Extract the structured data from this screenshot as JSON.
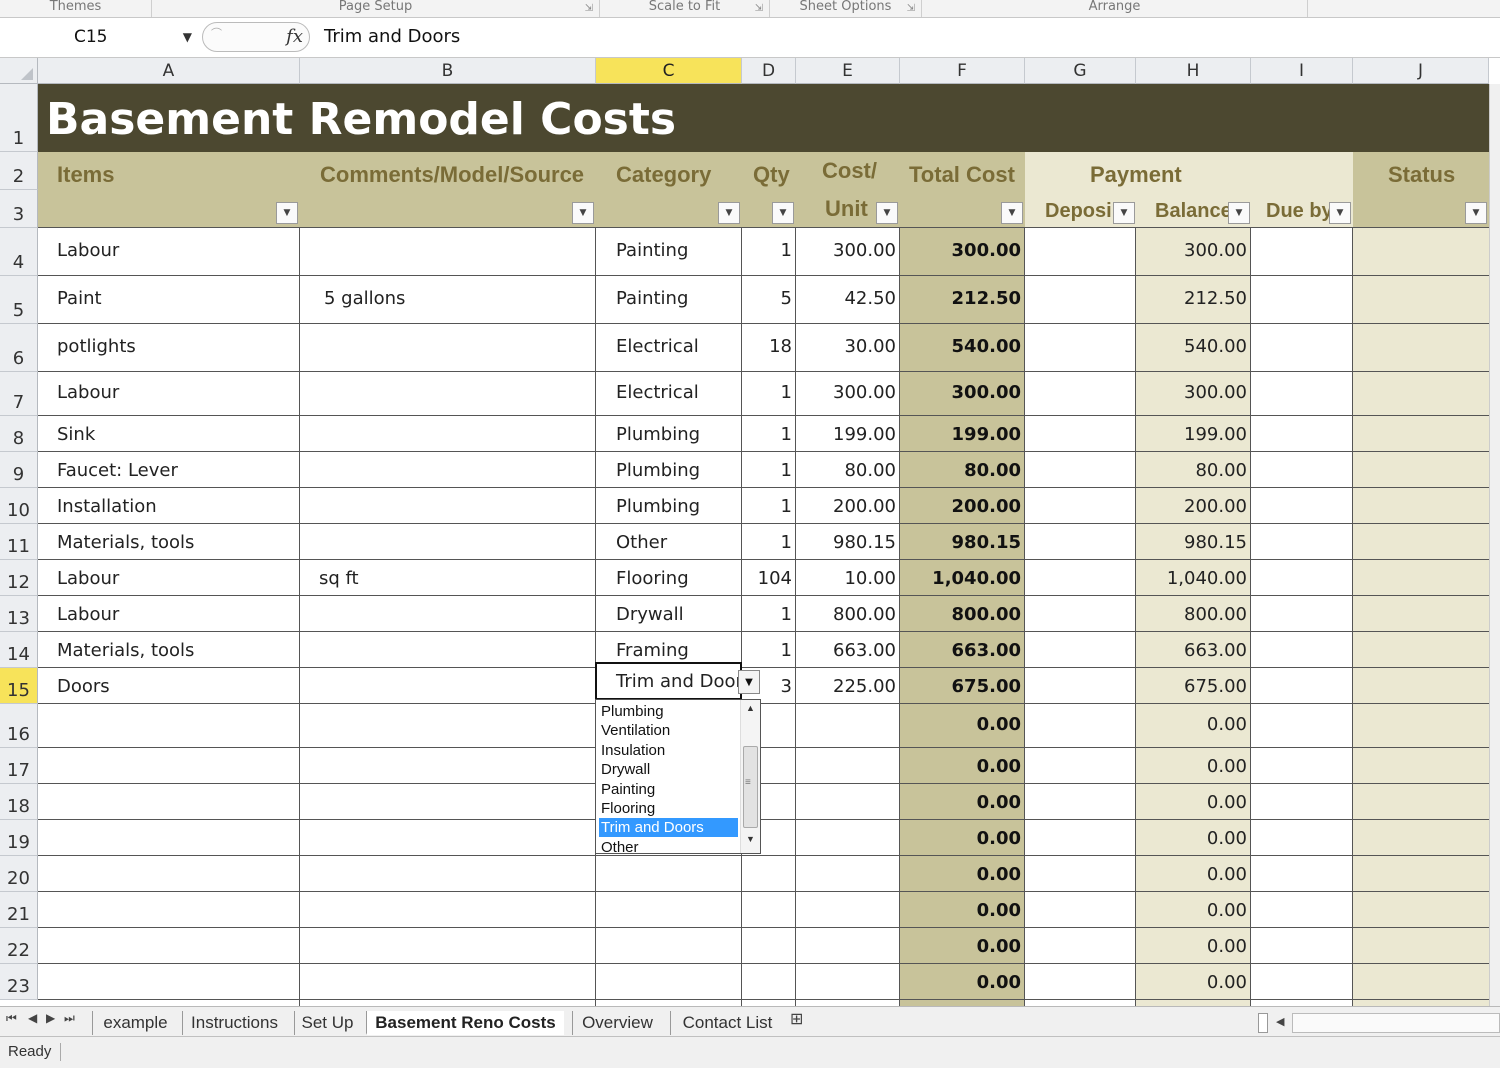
{
  "ribbon": {
    "groups": [
      "Themes",
      "Page Setup",
      "Scale to Fit",
      "Sheet Options",
      "Arrange"
    ]
  },
  "formula_bar": {
    "name_box": "C15",
    "fx_label": "fx",
    "value": "Trim and Doors"
  },
  "columns": [
    "A",
    "B",
    "C",
    "D",
    "E",
    "F",
    "G",
    "H",
    "I",
    "J"
  ],
  "sheet": {
    "title": "Basement Remodel Costs",
    "headers": {
      "items": "Items",
      "comments": "Comments/Model/Source",
      "category": "Category",
      "qty": "Qty",
      "cost_unit_1": "Cost/",
      "cost_unit_2": "Unit",
      "total_cost": "Total Cost",
      "payment": "Payment",
      "deposit": "Deposi",
      "balance": "Balance",
      "due_by": "Due by",
      "status": "Status"
    },
    "row_numbers": [
      "1",
      "2",
      "3",
      "4",
      "5",
      "6",
      "7",
      "8",
      "9",
      "10",
      "11",
      "12",
      "13",
      "14",
      "15",
      "16",
      "17",
      "18",
      "19",
      "20",
      "21",
      "22",
      "23"
    ],
    "rows": [
      {
        "item": "Labour",
        "comment": "",
        "category": "Painting",
        "qty": "1",
        "unit": "300.00",
        "total": "300.00",
        "balance": "300.00"
      },
      {
        "item": "Paint",
        "comment": "5 gallons",
        "category": "Painting",
        "qty": "5",
        "unit": "42.50",
        "total": "212.50",
        "balance": "212.50"
      },
      {
        "item": "potlights",
        "comment": "",
        "category": "Electrical",
        "qty": "18",
        "unit": "30.00",
        "total": "540.00",
        "balance": "540.00"
      },
      {
        "item": "Labour",
        "comment": "",
        "category": "Electrical",
        "qty": "1",
        "unit": "300.00",
        "total": "300.00",
        "balance": "300.00"
      },
      {
        "item": "Sink",
        "comment": "",
        "category": "Plumbing",
        "qty": "1",
        "unit": "199.00",
        "total": "199.00",
        "balance": "199.00"
      },
      {
        "item": "Faucet: Lever",
        "comment": "",
        "category": "Plumbing",
        "qty": "1",
        "unit": "80.00",
        "total": "80.00",
        "balance": "80.00"
      },
      {
        "item": "Installation",
        "comment": "",
        "category": "Plumbing",
        "qty": "1",
        "unit": "200.00",
        "total": "200.00",
        "balance": "200.00"
      },
      {
        "item": "Materials, tools",
        "comment": "",
        "category": "Other",
        "qty": "1",
        "unit": "980.15",
        "total": "980.15",
        "balance": "980.15"
      },
      {
        "item": "Labour",
        "comment": "sq ft",
        "category": "Flooring",
        "qty": "104",
        "unit": "10.00",
        "total": "1,040.00",
        "balance": "1,040.00"
      },
      {
        "item": "Labour",
        "comment": "",
        "category": "Drywall",
        "qty": "1",
        "unit": "800.00",
        "total": "800.00",
        "balance": "800.00"
      },
      {
        "item": "Materials, tools",
        "comment": "",
        "category": "Framing",
        "qty": "1",
        "unit": "663.00",
        "total": "663.00",
        "balance": "663.00"
      },
      {
        "item": "Doors",
        "comment": "",
        "category": "Trim and Doors",
        "qty": "3",
        "unit": "225.00",
        "total": "675.00",
        "balance": "675.00"
      },
      {
        "item": "",
        "comment": "",
        "category": "",
        "qty": "",
        "unit": "",
        "total": "0.00",
        "balance": "0.00"
      },
      {
        "item": "",
        "comment": "",
        "category": "",
        "qty": "",
        "unit": "",
        "total": "0.00",
        "balance": "0.00"
      },
      {
        "item": "",
        "comment": "",
        "category": "",
        "qty": "",
        "unit": "",
        "total": "0.00",
        "balance": "0.00"
      },
      {
        "item": "",
        "comment": "",
        "category": "",
        "qty": "",
        "unit": "",
        "total": "0.00",
        "balance": "0.00"
      },
      {
        "item": "",
        "comment": "",
        "category": "",
        "qty": "",
        "unit": "",
        "total": "0.00",
        "balance": "0.00"
      },
      {
        "item": "",
        "comment": "",
        "category": "",
        "qty": "",
        "unit": "",
        "total": "0.00",
        "balance": "0.00"
      },
      {
        "item": "",
        "comment": "",
        "category": "",
        "qty": "",
        "unit": "",
        "total": "0.00",
        "balance": "0.00"
      },
      {
        "item": "",
        "comment": "",
        "category": "",
        "qty": "",
        "unit": "",
        "total": "0.00",
        "balance": "0.00"
      }
    ]
  },
  "dropdown": {
    "options": [
      "Plumbing",
      "Ventilation",
      "Insulation",
      "Drywall",
      "Painting",
      "Flooring",
      "Trim and Doors",
      "Other"
    ],
    "selected": "Trim and Doors"
  },
  "tabs": [
    "example",
    "Instructions",
    "Set Up",
    "Basement Reno Costs",
    "Overview",
    "Contact List"
  ],
  "active_tab": "Basement Reno Costs",
  "status": "Ready",
  "colors": {
    "title_bg": "#4c4830",
    "header_bg": "#c8c39a",
    "header_text": "#7a6c37",
    "light_band": "#ebe8d2",
    "selected_header": "#f7e35a",
    "list_selection": "#3399ff"
  }
}
